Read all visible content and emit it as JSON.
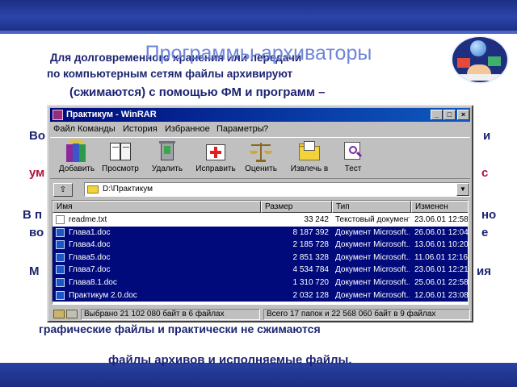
{
  "slide": {
    "title": "Программы-архиваторы",
    "para1_line1": "Для долговременного хранения или передачи",
    "para1_line2": "по компьютерным сетям файлы архивируют",
    "para1_line3": "(сжимаются) с помощью ФМ и программ –",
    "para2_left": "Во",
    "para2_right": "и",
    "para3_left": "ум",
    "para3_right": "с",
    "para4_left": "В п",
    "para4_right": "но",
    "para5_left": "во",
    "para5_right": "е",
    "para6_left": "М",
    "para6_right": "ия",
    "para7": "графические файлы и практически не сжимаются",
    "para8": "файлы архивов и исполняемые файлы."
  },
  "window": {
    "title": "Практикум - WinRAR",
    "menu": [
      "Файл",
      "Команды",
      "История",
      "Избранное",
      "Параметры",
      "?"
    ],
    "tools": [
      {
        "label": "Добавить",
        "icon": "add-books-icon"
      },
      {
        "label": "Просмотр",
        "icon": "view-book-icon"
      },
      {
        "label": "Удалить",
        "icon": "trash-icon"
      },
      {
        "label": "Исправить",
        "icon": "first-aid-icon"
      },
      {
        "label": "Оценить",
        "icon": "scales-icon"
      },
      {
        "label": "Извлечь в",
        "icon": "extract-folder-icon"
      },
      {
        "label": "Тест",
        "icon": "test-magnifier-icon"
      }
    ],
    "up_glyph": "⇧",
    "path": "D:\\Практикум",
    "dropdown_glyph": "▼",
    "columns": [
      "Имя",
      "Размер",
      "Тип",
      "Изменен"
    ],
    "files": [
      {
        "name": "readme.txt",
        "size": "33 242",
        "type": "Текстовый документ",
        "modified": "23.06.01 12:58",
        "selected": false
      },
      {
        "name": "Глава1.doc",
        "size": "8 187 392",
        "type": "Документ Microsoft...",
        "modified": "26.06.01 12:04",
        "selected": true
      },
      {
        "name": "Глава4.doc",
        "size": "2 185 728",
        "type": "Документ Microsoft...",
        "modified": "13.06.01 10:20",
        "selected": true
      },
      {
        "name": "Глава5.doc",
        "size": "2 851 328",
        "type": "Документ Microsoft...",
        "modified": "11.06.01 12:16",
        "selected": true
      },
      {
        "name": "Глава7.doc",
        "size": "4 534 784",
        "type": "Документ Microsoft...",
        "modified": "23.06.01 12:21",
        "selected": true
      },
      {
        "name": "Глава8.1.doc",
        "size": "1 310 720",
        "type": "Документ Microsoft...",
        "modified": "25.06.01 22:58",
        "selected": true
      },
      {
        "name": "Практикум 2.0.doc",
        "size": "2 032 128",
        "type": "Документ Microsoft...",
        "modified": "12.06.01 23:08",
        "selected": true
      }
    ],
    "status_selected": "Выбрано 21 102 080 байт в 6 файлах",
    "status_total": "Всего 17 папок и 22 568 060 байт в 9 файлах"
  }
}
